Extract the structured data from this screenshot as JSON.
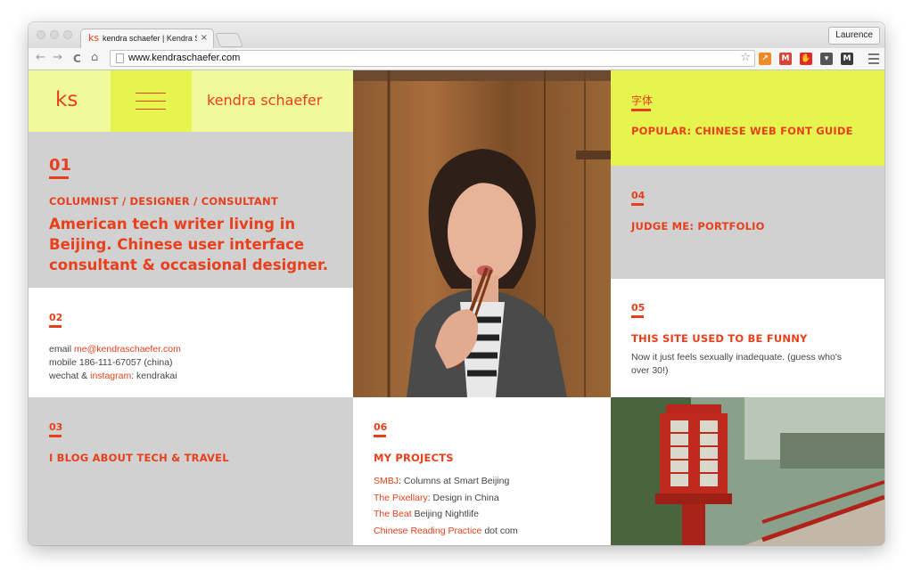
{
  "browser": {
    "tab_logo": "ks",
    "tab_title": "kendra schaefer | Kendra S",
    "tab_close": "×",
    "user_button": "Laurence",
    "url": "www.kendraschaefer.com",
    "back_icon": "←",
    "forward_icon": "→",
    "reload_icon": "C",
    "home_icon": "⌂",
    "star_icon": "☆",
    "extensions": [
      {
        "name": "analytics-extension-icon",
        "color": "#f08a24",
        "glyph": "↗"
      },
      {
        "name": "gmail-extension-icon",
        "color": "#d94438",
        "glyph": "M"
      },
      {
        "name": "adblock-extension-icon",
        "color": "#e02a24",
        "glyph": "✋"
      },
      {
        "name": "pocket-extension-icon",
        "color": "#555555",
        "glyph": "▾"
      },
      {
        "name": "m-extension-icon",
        "color": "#3a3a3a",
        "glyph": "M"
      }
    ]
  },
  "site": {
    "logo": "ks",
    "name": "kendra schaefer",
    "intro": {
      "number": "01",
      "heading": "COLUMNIST / DESIGNER / CONSULTANT",
      "lines": [
        "American tech writer living in",
        "Beijing. Chinese user interface",
        "consultant & occasional designer."
      ]
    },
    "contact": {
      "number": "02",
      "email_label": "email ",
      "email": "me@kendraschaefer.com",
      "mobile": "mobile 186-111-67057 (china)",
      "wechat_prefix": "wechat & ",
      "instagram": "instagram",
      "wechat_suffix": ": kendrakai"
    },
    "blog": {
      "number": "03",
      "heading": "I BLOG ABOUT TECH & TRAVEL"
    },
    "font_guide": {
      "icon": "字体",
      "heading": "POPULAR: CHINESE WEB FONT GUIDE"
    },
    "portfolio": {
      "number": "04",
      "heading": "JUDGE ME: PORTFOLIO"
    },
    "funny": {
      "number": "05",
      "heading": "THIS SITE USED TO BE FUNNY",
      "text_lines": [
        "Now it just feels sexually inadequate. (guess who's",
        "over 30!)"
      ]
    },
    "projects": {
      "number": "06",
      "heading": "MY PROJECTS",
      "items": [
        {
          "link": "SMBJ",
          "text": ": Columns at Smart Beijing"
        },
        {
          "link": "The Pixellary",
          "text": ": Design in China"
        },
        {
          "link": "The Beat",
          "text": " Beijing Nightlife"
        },
        {
          "link": "Chinese Reading Practice",
          "text": " dot com"
        }
      ]
    },
    "colors": {
      "accent": "#e8401c",
      "yellow": "#e6f44f",
      "pale_yellow": "#f1f99a",
      "gray": "#d1d1d1"
    }
  }
}
